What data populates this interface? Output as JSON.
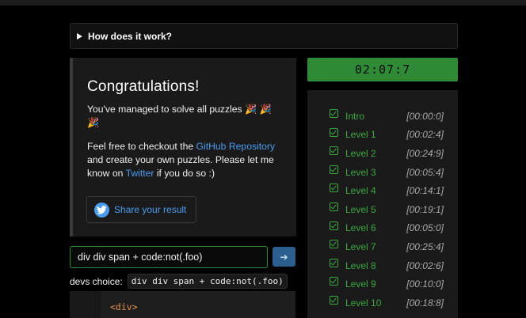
{
  "how": {
    "label": "How does it work?"
  },
  "card": {
    "title": "Congratulations!",
    "solved_text": "You've managed to solve all puzzles 🎉 🎉 🎉",
    "free_text_before": "Feel free to checkout the ",
    "repo_link": "GitHub Repository",
    "free_text_middle": " and create your own puzzles. Please let me know on ",
    "twitter_link": "Twitter",
    "free_text_after": " if you do so :)",
    "share_label": "Share your result"
  },
  "input": {
    "value": "div div span + code:not(.foo)"
  },
  "devs": {
    "label": "devs choice:",
    "code": "div div span + code:not(.foo)"
  },
  "editor": {
    "first_line": "<div>"
  },
  "timer": {
    "value": "02:07:7"
  },
  "levels": [
    {
      "name": "Intro",
      "time": "[00:00:0]"
    },
    {
      "name": "Level 1",
      "time": "[00:02:4]"
    },
    {
      "name": "Level 2",
      "time": "[00:24:9]"
    },
    {
      "name": "Level 3",
      "time": "[00:05:4]"
    },
    {
      "name": "Level 4",
      "time": "[00:14:1]"
    },
    {
      "name": "Level 5",
      "time": "[00:19:1]"
    },
    {
      "name": "Level 6",
      "time": "[00:05:0]"
    },
    {
      "name": "Level 7",
      "time": "[00:25:4]"
    },
    {
      "name": "Level 8",
      "time": "[00:02:6]"
    },
    {
      "name": "Level 9",
      "time": "[00:10:0]"
    },
    {
      "name": "Level 10",
      "time": "[00:18:8]"
    }
  ],
  "colors": {
    "accent_green": "#3aa83f",
    "timer_bg": "#2e8a34",
    "link_blue": "#4a9cf0",
    "submit_button": "#2b5f8f"
  },
  "icons": {
    "expand": "triangle-right-icon",
    "share": "twitter-icon",
    "submit": "arrow-right-icon",
    "level_done": "check-square-icon"
  }
}
